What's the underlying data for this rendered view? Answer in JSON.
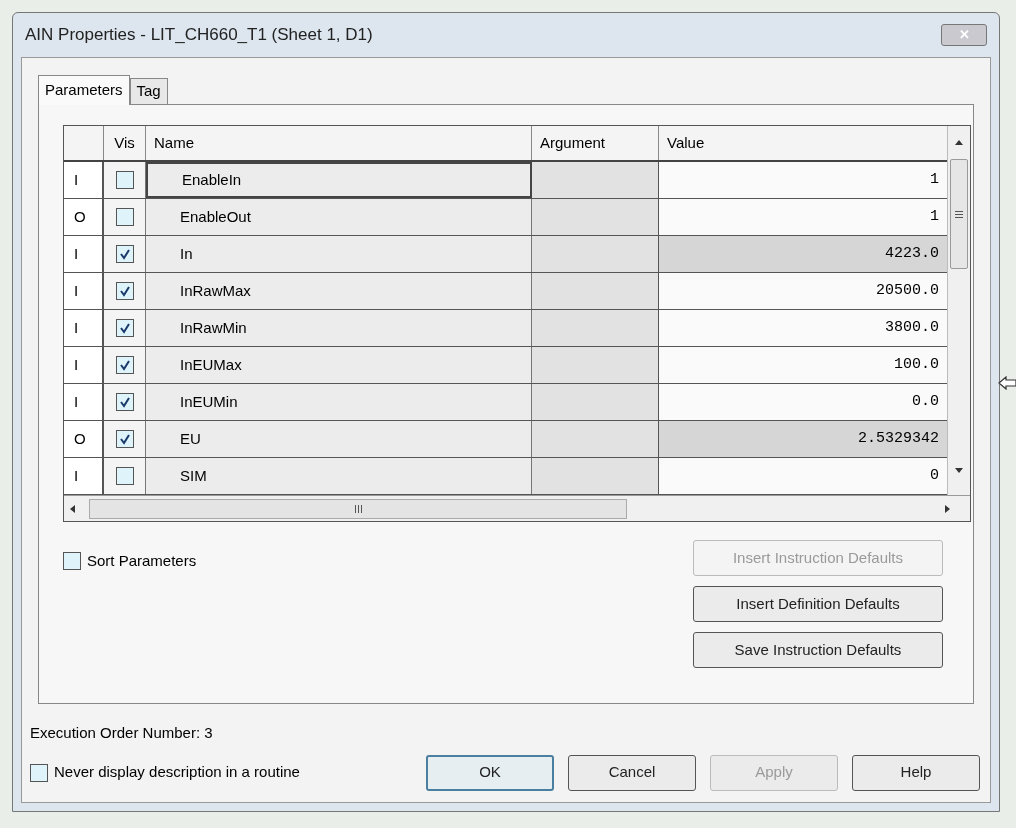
{
  "window": {
    "title": "AIN Properties - LIT_CH660_T1 (Sheet 1, D1)",
    "close_label": "✕"
  },
  "tabs": [
    {
      "label": "Parameters",
      "selected": true
    },
    {
      "label": "Tag",
      "selected": false
    }
  ],
  "table": {
    "columns": [
      "Vis",
      "Name",
      "Argument",
      "Value"
    ],
    "rows": [
      {
        "io": "I",
        "vis": false,
        "name": "EnableIn",
        "argument": "",
        "value": "1",
        "selected": true,
        "shaded": false
      },
      {
        "io": "O",
        "vis": false,
        "name": "EnableOut",
        "argument": "",
        "value": "1",
        "selected": false,
        "shaded": false
      },
      {
        "io": "I",
        "vis": true,
        "name": "In",
        "argument": "",
        "value": "4223.0",
        "selected": false,
        "shaded": true
      },
      {
        "io": "I",
        "vis": true,
        "name": "InRawMax",
        "argument": "",
        "value": "20500.0",
        "selected": false,
        "shaded": false
      },
      {
        "io": "I",
        "vis": true,
        "name": "InRawMin",
        "argument": "",
        "value": "3800.0",
        "selected": false,
        "shaded": false
      },
      {
        "io": "I",
        "vis": true,
        "name": "InEUMax",
        "argument": "",
        "value": "100.0",
        "selected": false,
        "shaded": false
      },
      {
        "io": "I",
        "vis": true,
        "name": "InEUMin",
        "argument": "",
        "value": "0.0",
        "selected": false,
        "shaded": false
      },
      {
        "io": "O",
        "vis": true,
        "name": "EU",
        "argument": "",
        "value": "2.5329342",
        "selected": false,
        "shaded": true
      },
      {
        "io": "I",
        "vis": false,
        "name": "SIM",
        "argument": "",
        "value": "0",
        "selected": false,
        "shaded": false
      }
    ]
  },
  "sort_parameters": {
    "label": "Sort Parameters",
    "checked": false
  },
  "side_buttons": [
    {
      "label": "Insert Instruction Defaults",
      "disabled": true
    },
    {
      "label": "Insert Definition Defaults",
      "disabled": false
    },
    {
      "label": "Save Instruction Defaults",
      "disabled": false
    }
  ],
  "execution_order": "Execution Order Number: 3",
  "never_display": {
    "label": "Never display description in a routine",
    "checked": false
  },
  "buttons": [
    {
      "label": "OK",
      "disabled": false,
      "default": true
    },
    {
      "label": "Cancel",
      "disabled": false,
      "default": false
    },
    {
      "label": "Apply",
      "disabled": true,
      "default": false
    },
    {
      "label": "Help",
      "disabled": false,
      "default": false
    }
  ]
}
